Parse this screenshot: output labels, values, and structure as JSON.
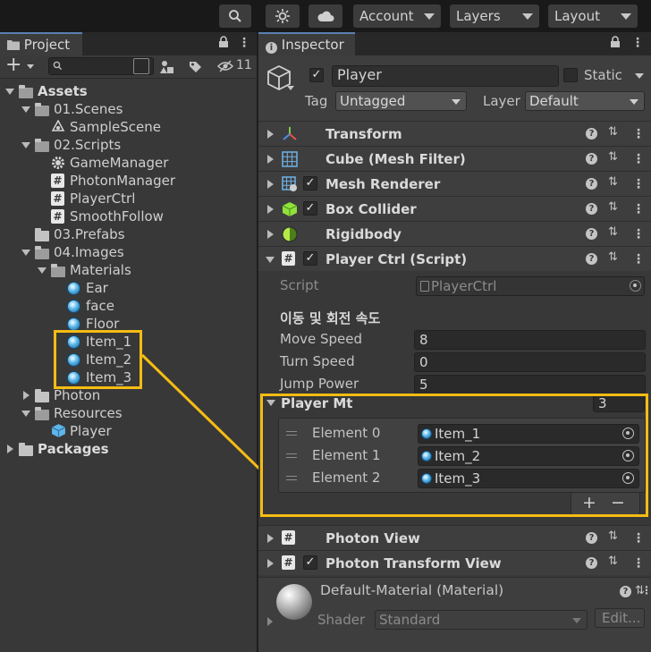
{
  "toolbar": {
    "account": "Account",
    "layers": "Layers",
    "layout": "Layout",
    "icons": [
      "search-icon",
      "collab-icon",
      "cloud-icon"
    ]
  },
  "project": {
    "tab": "Project",
    "visible_count": "11",
    "tree": [
      {
        "label": "Assets",
        "kind": "folder-open",
        "bold": true
      },
      {
        "label": "01.Scenes",
        "kind": "folder-open"
      },
      {
        "label": "SampleScene",
        "kind": "scene"
      },
      {
        "label": "02.Scripts",
        "kind": "folder-open"
      },
      {
        "label": "GameManager",
        "kind": "gear"
      },
      {
        "label": "PhotonManager",
        "kind": "script"
      },
      {
        "label": "PlayerCtrl",
        "kind": "script"
      },
      {
        "label": "SmoothFollow",
        "kind": "script"
      },
      {
        "label": "03.Prefabs",
        "kind": "folder"
      },
      {
        "label": "04.Images",
        "kind": "folder-open"
      },
      {
        "label": "Materials",
        "kind": "folder-open"
      },
      {
        "label": "Ear",
        "kind": "material"
      },
      {
        "label": "face",
        "kind": "material"
      },
      {
        "label": "Floor",
        "kind": "material"
      },
      {
        "label": "Item_1",
        "kind": "material"
      },
      {
        "label": "Item_2",
        "kind": "material"
      },
      {
        "label": "Item_3",
        "kind": "material"
      },
      {
        "label": "Photon",
        "kind": "folder"
      },
      {
        "label": "Resources",
        "kind": "folder-open"
      },
      {
        "label": "Player",
        "kind": "prefab"
      },
      {
        "label": "Packages",
        "kind": "folder",
        "bold": true
      }
    ]
  },
  "inspector": {
    "tab": "Inspector",
    "object_name": "Player",
    "static_label": "Static",
    "tag_label": "Tag",
    "tag_value": "Untagged",
    "layer_label": "Layer",
    "layer_value": "Default",
    "components": [
      {
        "name": "Transform",
        "checkbox": false,
        "icon": "transform-icon"
      },
      {
        "name": "Cube (Mesh Filter)",
        "checkbox": false,
        "icon": "mesh-filter-icon"
      },
      {
        "name": "Mesh Renderer",
        "checkbox": true,
        "icon": "mesh-renderer-icon"
      },
      {
        "name": "Box Collider",
        "checkbox": true,
        "icon": "box-collider-icon"
      },
      {
        "name": "Rigidbody",
        "checkbox": false,
        "icon": "rigidbody-icon"
      },
      {
        "name": "Player Ctrl (Script)",
        "checkbox": true,
        "icon": "script-icon"
      }
    ],
    "script": {
      "label": "Script",
      "value": "PlayerCtrl"
    },
    "header_korean": "이동 및 회전 속도",
    "properties": [
      {
        "label": "Move Speed",
        "value": "8"
      },
      {
        "label": "Turn Speed",
        "value": "0"
      },
      {
        "label": "Jump Power",
        "value": "5"
      }
    ],
    "player_mt": {
      "label": "Player Mt",
      "size": "3",
      "elements": [
        {
          "label": "Element 0",
          "value": "Item_1"
        },
        {
          "label": "Element 1",
          "value": "Item_2"
        },
        {
          "label": "Element 2",
          "value": "Item_3"
        }
      ],
      "add": "+",
      "remove": "−"
    },
    "more_components": [
      {
        "name": "Photon View",
        "checkbox": false
      },
      {
        "name": "Photon Transform View",
        "checkbox": true
      }
    ],
    "material": {
      "name": "Default-Material (Material)",
      "shader_label": "Shader",
      "shader_value": "Standard",
      "edit": "Edit..."
    }
  },
  "colors": {
    "highlight": "#f5bc13",
    "panel": "#383838",
    "accent": "#5a7fb3"
  }
}
